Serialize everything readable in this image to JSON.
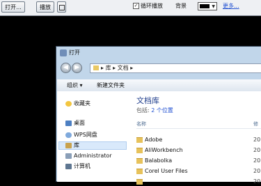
{
  "toolbar": {
    "open_label": "打开...",
    "play_label": "播放",
    "loop_label": "循环播放",
    "loop_checked": true,
    "bg_label": "背景",
    "bg_color": "#000000",
    "more_label": "更多..."
  },
  "dialog": {
    "title": "打开",
    "breadcrumb": [
      "库",
      "文档"
    ],
    "organize_label": "组织 ▾",
    "new_folder_label": "新建文件夹",
    "nav": [
      {
        "label": "收藏夹",
        "icon": "star-icon"
      },
      {
        "label": "桌面",
        "icon": "desktop-icon"
      },
      {
        "label": "WPS网盘",
        "icon": "cloud-icon"
      },
      {
        "label": "库",
        "icon": "library-icon",
        "selected": true
      },
      {
        "label": "Administrator",
        "icon": "user-icon"
      },
      {
        "label": "计算机",
        "icon": "computer-icon"
      }
    ],
    "library_title": "文档库",
    "includes_label": "包括:",
    "locations_link": "2 个位置",
    "column_name": "名称",
    "column_date": "修",
    "files": [
      {
        "name": "Adobe",
        "date": "201"
      },
      {
        "name": "AliWorkbench",
        "date": "201"
      },
      {
        "name": "Balabolka",
        "date": "201"
      },
      {
        "name": "Corel User Files",
        "date": "201"
      },
      {
        "name": "",
        "date": "201"
      }
    ]
  },
  "colors": {
    "accent": "#1f4fd1",
    "titlebar": "#c1d6ea",
    "library_title": "#1e3d8c"
  }
}
